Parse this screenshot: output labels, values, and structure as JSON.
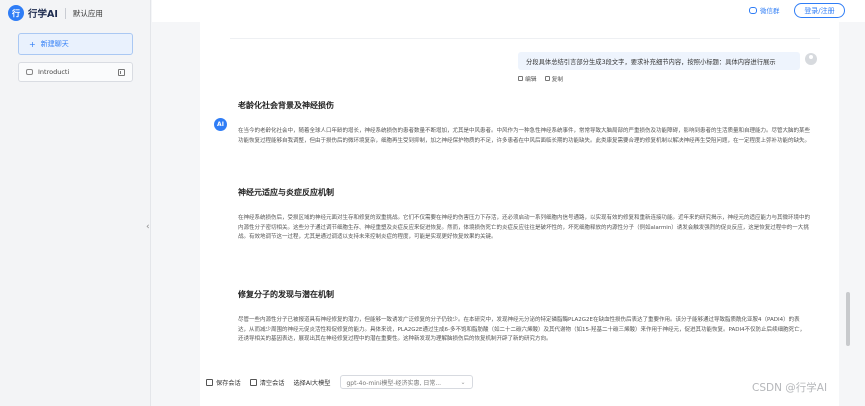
{
  "brand": {
    "logo": "行",
    "name": "行学AI",
    "app": "默认应用"
  },
  "sidebar": {
    "new_chat": {
      "icon": "+",
      "label": "新建聊天"
    },
    "conversations": [
      {
        "label": "Introducti",
        "icon": "chat-icon",
        "delete_icon": "trash-icon"
      }
    ]
  },
  "header": {
    "wechat_label": "微信群",
    "login_label": "登录/注册"
  },
  "chat": {
    "user_message": "分段具体总结引言部分生成3段文字，要求补充细节内容，按照小标题：具体内容进行展示",
    "user_actions": {
      "edit": "编辑",
      "copy": "复制"
    },
    "ai_avatar": "AI",
    "sections": [
      {
        "title": "老龄化社会背景及神经损伤",
        "body": "在当今的老龄化社会中，随着全球人口年龄的增长，神经系统损伤的患者数量不断增加，尤其是中风患者。中风作为一种急性神经系统事件，常常导致大脑局部的严重损伤及功能障碍，影响到患者的生活质量和自理能力。尽管大脑的某些功能恢复过程能够自我调整，但由于损伤后的微环境复杂，细胞再生受到抑制，加之神经保护物质的不足，许多患者在中风后面临长期的功能缺失。此类康复需要合理的修复机制以解决神经再生受阻问题，在一定程度上弥补功能的缺失。"
      },
      {
        "title": "神经元适应与炎症反应机制",
        "body": "在神经系统损伤后，受损区域的神经元面对生存和修复的双重挑战。它们不仅需要在神经的伤害压力下存活，还必须启动一系列细胞内信号通路，以实现有效的修复和重新连接功能。近年来的研究揭示，神经元的适应能力与其微环境中的内源性分子密切相关。这些分子通过调节细胞生存、神经重塑及炎症反应来促进恢复。然而，体境损伤死亡的炎症反应往往是破坏性的，坏死细胞释放的内源性分子（例如alarmin）诱发会触发强烈的促炎反应，这是恢复过程中的一大挑战。有效地调节这一过程，尤其是通过调适以支持未来控制炎症的程度，可能是实现更好恢复效果的关键。"
      },
      {
        "title": "修复分子的发现与潜在机制",
        "body": "尽管一些内源性分子已被报道具有神经修复的潜力，但能够一致诱发广泛修复的分子仍较少。在本研究中，发现神经元分泌的特定磷脂酶PLA2G2E在缺血性损伤后表达了重要作用。该分子能够通过导致脂质酰化亚胺4（PADI4）的表达，从而减少周围的神经元促炎活性和促修复的能力。具体来说，PLA2G2E通过生成6-多不饱和脂肪酸（如二十二碳六烯酸）及其代谢物（如15-羟基二十碳三烯酸）来作用于神经元，促进其功能恢复。PADI4不仅防止后续细胞死亡，还诱导相关的基因表达，展现出其在神经修复过程中的潜在重要性。这种新发现为理解脑损伤后的恢复机制开辟了新的研究方向。"
      }
    ]
  },
  "toolbar": {
    "save_label": "保存会话",
    "clear_label": "清空会话",
    "model_label": "选择AI大模型",
    "model_value": "gpt-4o-mini模型-经济实惠, 日常..."
  },
  "watermark": "CSDN @行学AI"
}
